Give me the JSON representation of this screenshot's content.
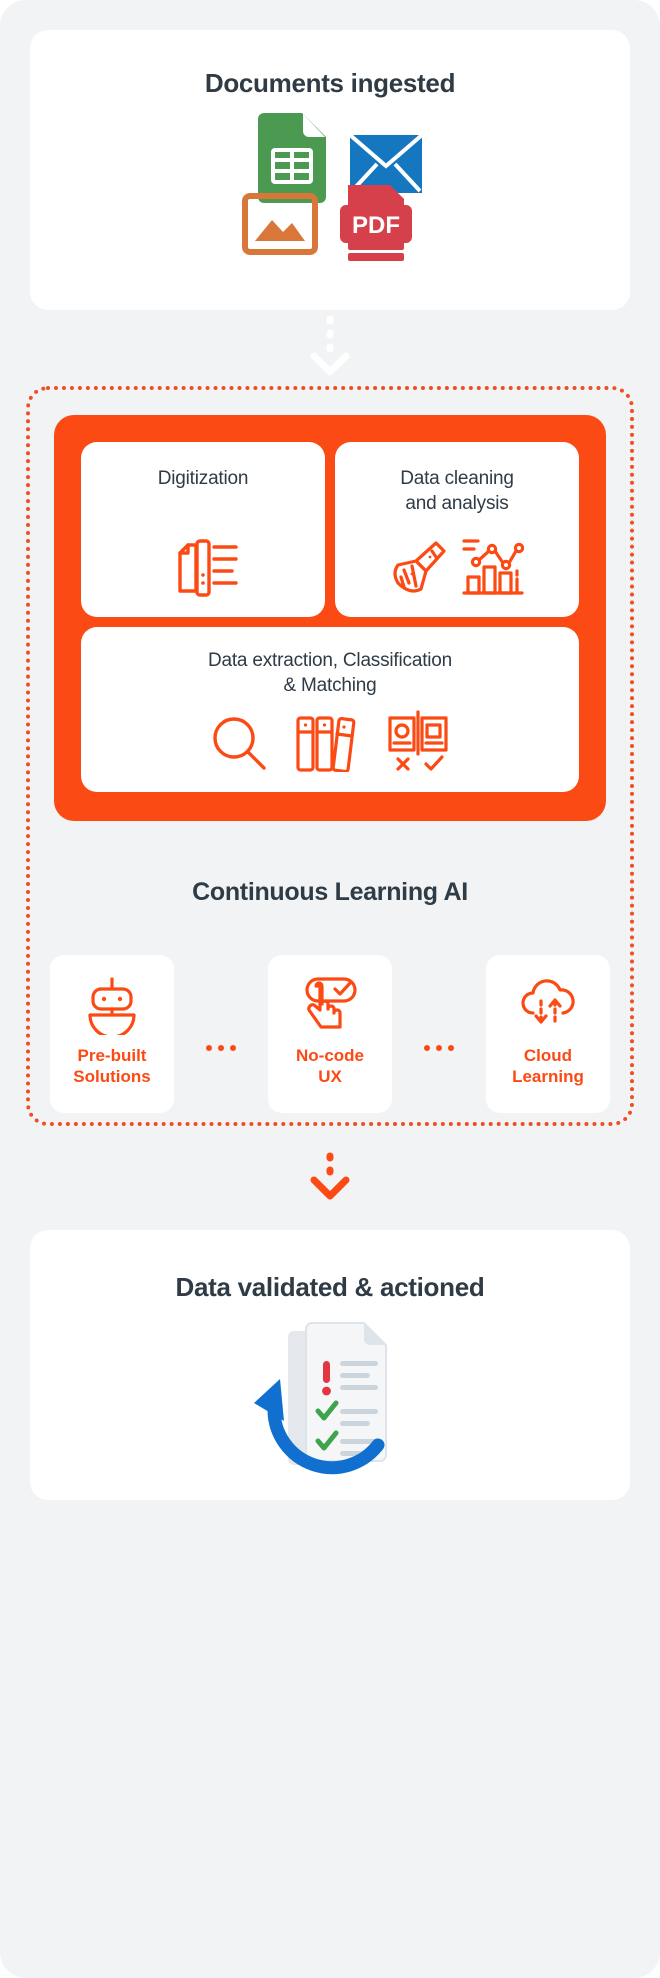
{
  "theme": {
    "accent": "#fb4a13",
    "accent_dark": "#f04e23",
    "heading": "#2f3b45",
    "page_bg": "#f2f3f4",
    "card_bg": "#ffffff",
    "sheet_green": "#4c9a51",
    "mail_blue": "#1577c0",
    "image_orange": "#d9763a",
    "pdf_red": "#d6404a",
    "arrow_blue": "#1170cf",
    "check_green": "#3ea34a",
    "alert_red": "#e2373f"
  },
  "top_card": {
    "title": "Documents ingested",
    "icons": [
      {
        "name": "spreadsheet-document-icon",
        "label": "Spreadsheet"
      },
      {
        "name": "email-envelope-icon",
        "label": "Email"
      },
      {
        "name": "image-file-icon",
        "label": "Image"
      },
      {
        "name": "pdf-file-icon",
        "label": "PDF"
      }
    ],
    "pdf_text": "PDF"
  },
  "connector_top": {
    "name": "dotted-arrow-down",
    "color": "#ffffff"
  },
  "processing": {
    "cards": [
      {
        "label": "Digitization",
        "icons": [
          {
            "name": "document-scanner-icon"
          }
        ]
      },
      {
        "label": "Data cleaning\nand analysis",
        "label_line1": "Data cleaning",
        "label_line2": "and analysis",
        "icons": [
          {
            "name": "broom-icon"
          },
          {
            "name": "analytics-chart-icon"
          }
        ]
      },
      {
        "label": "Data extraction, Classification & Matching",
        "label_line1": "Data extraction, Classification",
        "label_line2": "& Matching",
        "icons": [
          {
            "name": "magnifying-glass-icon"
          },
          {
            "name": "books-archive-icon"
          },
          {
            "name": "match-compare-icon"
          }
        ]
      }
    ]
  },
  "continuous_learning": {
    "heading": "Continuous Learning AI",
    "cards": [
      {
        "icon": "robot-icon",
        "label_line1": "Pre-built",
        "label_line2": "Solutions"
      },
      {
        "icon": "tap-check-hand-icon",
        "label_line1": "No-code",
        "label_line2": "UX"
      },
      {
        "icon": "cloud-sync-icon",
        "label_line1": "Cloud",
        "label_line2": "Learning"
      }
    ],
    "connector": {
      "name": "dotted-link",
      "dots": 3
    }
  },
  "connector_bottom": {
    "name": "dotted-arrow-down",
    "color": "#fb4a13"
  },
  "bottom_card": {
    "title": "Data validated & actioned",
    "illustration": {
      "name": "validated-document-illustration",
      "parts": [
        {
          "name": "document-page-icon"
        },
        {
          "name": "alert-exclamation-icon"
        },
        {
          "name": "check-mark-icon"
        },
        {
          "name": "check-mark-icon"
        },
        {
          "name": "circular-arrow-icon"
        }
      ]
    }
  }
}
